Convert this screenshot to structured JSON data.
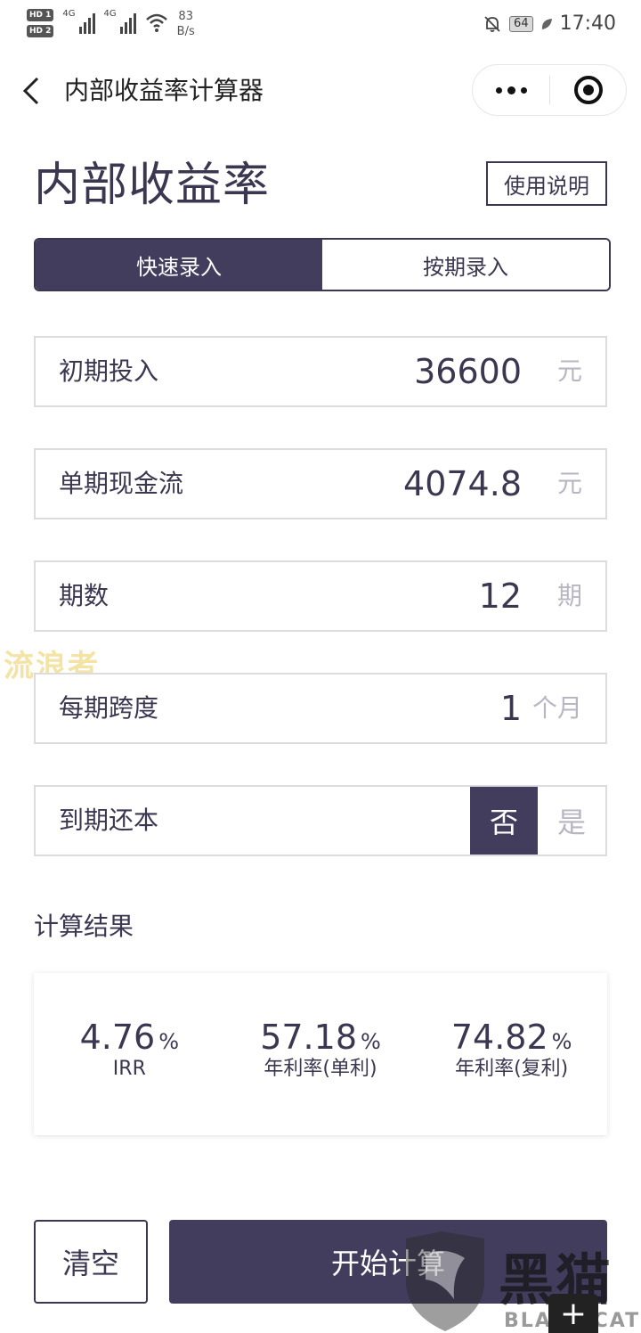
{
  "status_bar": {
    "hd1": "HD 1",
    "hd2": "HD 2",
    "net1": "4G",
    "net2": "4G",
    "speed_value": "83",
    "speed_unit": "B/s",
    "battery": "64",
    "time": "17:40"
  },
  "nav": {
    "title": "内部收益率计算器"
  },
  "header": {
    "title": "内部收益率",
    "help_label": "使用说明"
  },
  "tabs": [
    {
      "label": "快速录入",
      "active": true
    },
    {
      "label": "按期录入",
      "active": false
    }
  ],
  "fields": {
    "initial": {
      "label": "初期投入",
      "value": "36600",
      "unit": "元"
    },
    "cashflow": {
      "label": "单期现金流",
      "value": "4074.8",
      "unit": "元"
    },
    "periods": {
      "label": "期数",
      "value": "12",
      "unit": "期"
    },
    "span": {
      "label": "每期跨度",
      "value": "1",
      "unit": "个月"
    },
    "principal": {
      "label": "到期还本",
      "option_no": "否",
      "option_yes": "是",
      "selected": "否"
    }
  },
  "results": {
    "title": "计算结果",
    "pct": "%",
    "irr": {
      "value": "4.76",
      "label": "IRR"
    },
    "simple": {
      "value": "57.18",
      "label": "年利率(单利)"
    },
    "compound": {
      "value": "74.82",
      "label": "年利率(复利)"
    }
  },
  "actions": {
    "clear": "清空",
    "start": "开始计算"
  },
  "watermarks": {
    "left": "流浪者",
    "brand_cn": "黑猫",
    "brand_en": "BLACK CAT"
  },
  "colors": {
    "primary": "#433d5d",
    "text": "#3c3750",
    "muted": "#b8b6c2",
    "border": "#dcdbe2"
  }
}
